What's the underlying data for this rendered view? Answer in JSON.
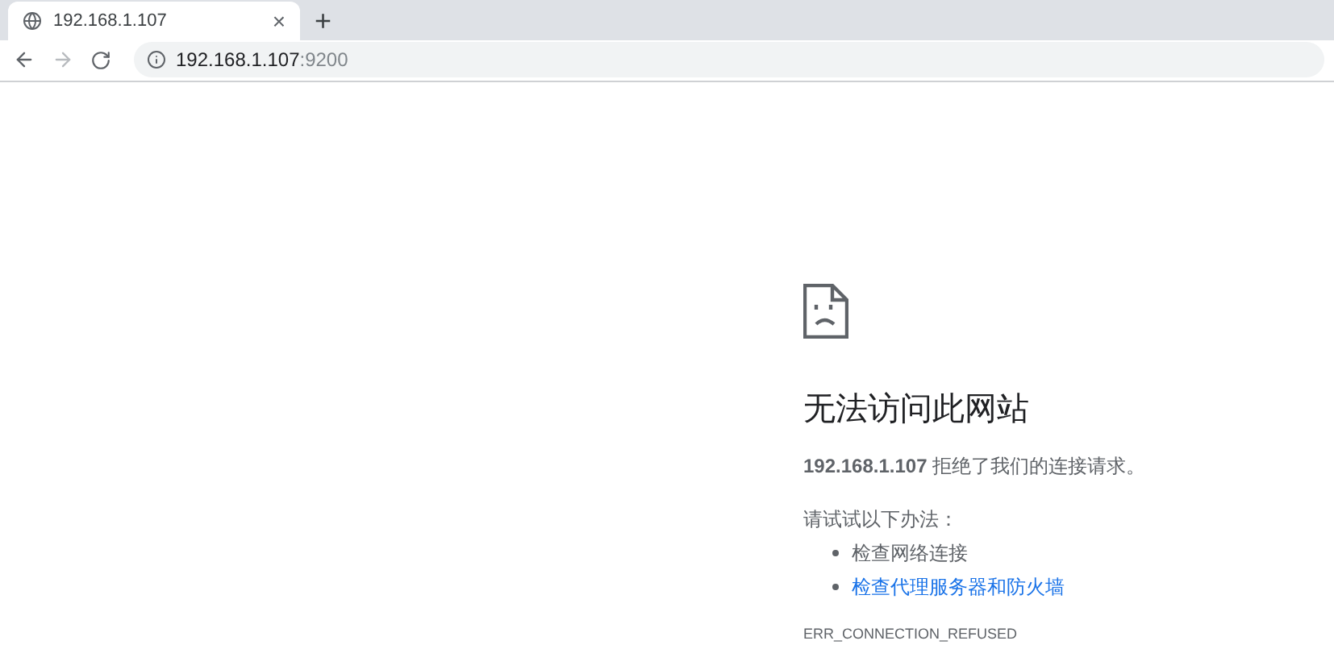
{
  "tab": {
    "title": "192.168.1.107",
    "close": "×",
    "new_tab": "+"
  },
  "address_bar": {
    "host": "192.168.1.107",
    "port": ":9200"
  },
  "error": {
    "heading": "无法访问此网站",
    "message": "**192.168.1.107** 拒绝了我们的连接请求。",
    "suggestion_intro": "请试试以下办法：",
    "suggestions": [
      {
        "kind": "text",
        "label": "检查网络连接"
      },
      {
        "kind": "link",
        "label": "检查代理服务器和防火墙"
      }
    ],
    "code": "ERR_CONNECTION_REFUSED"
  }
}
